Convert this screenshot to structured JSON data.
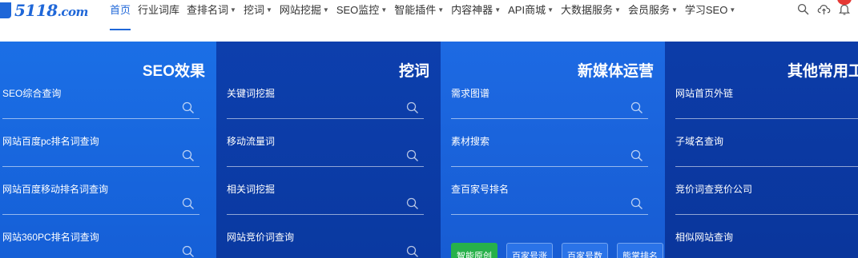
{
  "logo": {
    "text": "5118",
    "domain": ".com"
  },
  "nav": {
    "items": [
      {
        "label": "首页",
        "active": true,
        "has_menu": false
      },
      {
        "label": "行业词库",
        "active": false,
        "has_menu": false
      },
      {
        "label": "查排名词",
        "active": false,
        "has_menu": true
      },
      {
        "label": "挖词",
        "active": false,
        "has_menu": true
      },
      {
        "label": "网站挖掘",
        "active": false,
        "has_menu": true
      },
      {
        "label": "SEO监控",
        "active": false,
        "has_menu": true
      },
      {
        "label": "智能插件",
        "active": false,
        "has_menu": true
      },
      {
        "label": "内容神器",
        "active": false,
        "has_menu": true
      },
      {
        "label": "API商城",
        "active": false,
        "has_menu": true
      },
      {
        "label": "大数据服务",
        "active": false,
        "has_menu": true
      },
      {
        "label": "会员服务",
        "active": false,
        "has_menu": true
      },
      {
        "label": "学习SEO",
        "active": false,
        "has_menu": true
      }
    ],
    "caret": "▼",
    "icons": [
      "search-icon",
      "cloud-upload-icon",
      "bell-icon"
    ]
  },
  "panels": [
    {
      "title": "SEO效果",
      "fields": [
        {
          "label": "SEO综合查询"
        },
        {
          "label": "网站百度pc排名词查询"
        },
        {
          "label": "网站百度移动排名词查询"
        },
        {
          "label": "网站360PC排名词查询"
        }
      ]
    },
    {
      "title": "挖词",
      "fields": [
        {
          "label": "关键词挖掘"
        },
        {
          "label": "移动流量词"
        },
        {
          "label": "相关词挖掘"
        },
        {
          "label": "网站竞价词查询"
        }
      ]
    },
    {
      "title": "新媒体运营",
      "fields": [
        {
          "label": "需求图谱"
        },
        {
          "label": "素材搜索"
        },
        {
          "label": "查百家号排名"
        }
      ],
      "tags": [
        {
          "label": "智能原创",
          "style": "green"
        },
        {
          "label": "百家号涨",
          "style": "blue"
        },
        {
          "label": "百家号数",
          "style": "blue"
        },
        {
          "label": "熊掌排名",
          "style": "blue"
        }
      ]
    },
    {
      "title": "其他常用工",
      "fields": [
        {
          "label": "网站首页外链"
        },
        {
          "label": "子域名查询"
        },
        {
          "label": "竞价词查竞价公司"
        },
        {
          "label": "相似网站查询"
        }
      ]
    }
  ],
  "colors": {
    "brand": "#1f67d8",
    "panel_light": "#1b6fe6",
    "panel_dark": "#0d3fad",
    "tag_green": "#27b14a",
    "notification_dot": "#e53935"
  }
}
